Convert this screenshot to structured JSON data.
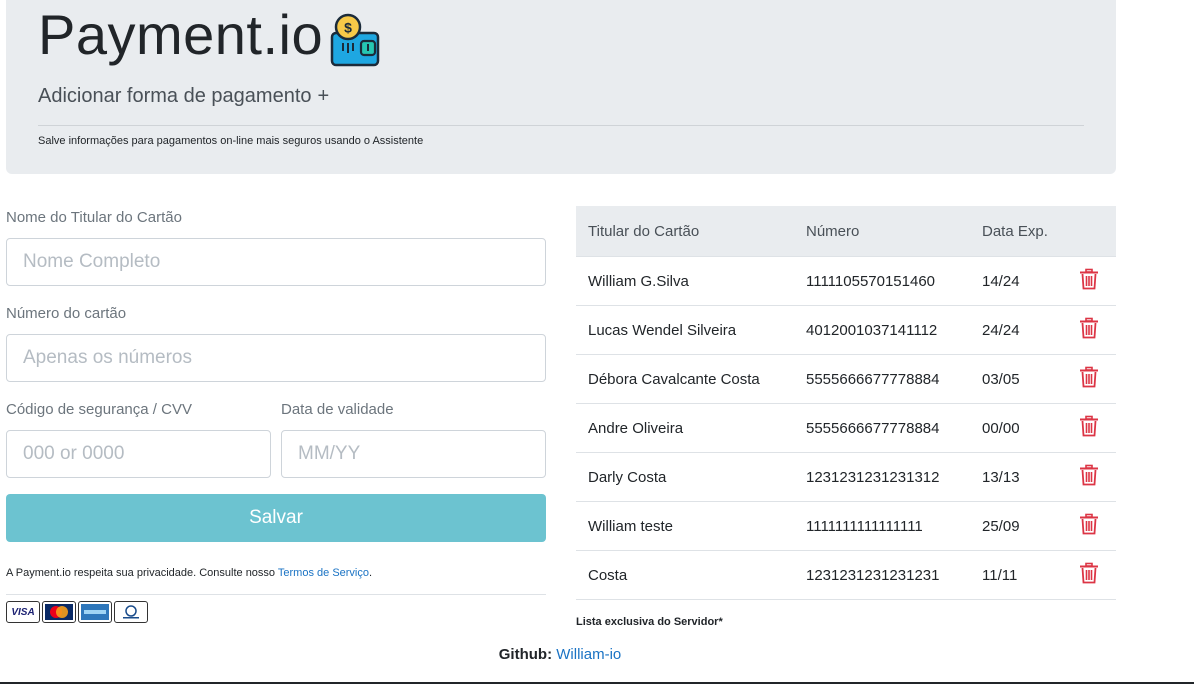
{
  "header": {
    "title": "Payment.io",
    "add_label": "Adicionar forma de pagamento",
    "add_symbol": "+",
    "lead": "Salve informações para pagamentos on-line mais seguros usando o Assistente",
    "wallet_icon": "wallet-coin-icon"
  },
  "form": {
    "name_label": "Nome do Titular do Cartão",
    "name_placeholder": "Nome Completo",
    "number_label": "Número do cartão",
    "number_placeholder": "Apenas os números",
    "cvv_label": "Código de segurança / CVV",
    "cvv_placeholder": "000 or 0000",
    "expiry_label": "Data de validade",
    "expiry_placeholder": "MM/YY",
    "save_label": "Salvar",
    "save_color": "#6cc3d0",
    "privacy_text": "A Payment.io respeita sua privacidade. Consulte nosso",
    "terms_link": "Termos de Serviço",
    "privacy_end": ".",
    "card_brands": [
      "VISA",
      "MasterCard",
      "American Express",
      "Diners Club"
    ]
  },
  "table": {
    "headers": [
      "Titular do Cartão",
      "Número",
      "Data Exp."
    ],
    "rows": [
      {
        "holder": "William G.Silva",
        "number": "1111105570151460",
        "exp": "14/24"
      },
      {
        "holder": "Lucas Wendel Silveira",
        "number": "4012001037141112",
        "exp": "24/24"
      },
      {
        "holder": "Débora Cavalcante Costa",
        "number": "5555666677778884",
        "exp": "03/05"
      },
      {
        "holder": "Andre Oliveira",
        "number": "5555666677778884",
        "exp": "00/00"
      },
      {
        "holder": "Darly Costa",
        "number": "1231231231231312",
        "exp": "13/13"
      },
      {
        "holder": "William teste",
        "number": "1111111111111111",
        "exp": "25/09"
      },
      {
        "holder": "Costa",
        "number": "1231231231231231",
        "exp": "11/11"
      }
    ],
    "delete_icon": "trash-icon",
    "delete_color": "#dc3545",
    "note": "Lista exclusiva do Servidor*"
  },
  "footer": {
    "github_label": "Github:",
    "github_link": "William-io"
  }
}
